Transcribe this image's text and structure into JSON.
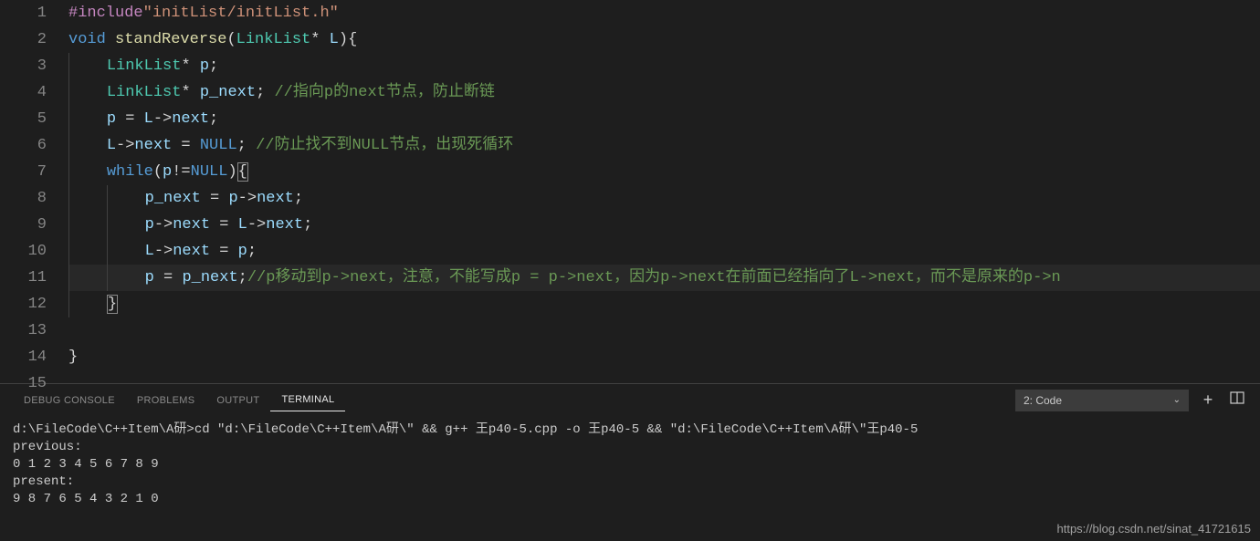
{
  "editor": {
    "lines": [
      {
        "num": "1",
        "indent": 0,
        "tokens": [
          {
            "t": "#include",
            "c": "tok-preproc"
          },
          {
            "t": "\"initList/initList.h\"",
            "c": "tok-string"
          }
        ]
      },
      {
        "num": "2",
        "indent": 0,
        "tokens": [
          {
            "t": "void",
            "c": "tok-keyword"
          },
          {
            "t": " ",
            "c": ""
          },
          {
            "t": "standReverse",
            "c": "tok-func"
          },
          {
            "t": "(",
            "c": "tok-punct"
          },
          {
            "t": "LinkList",
            "c": "tok-type"
          },
          {
            "t": "*",
            "c": "tok-op"
          },
          {
            "t": " ",
            "c": ""
          },
          {
            "t": "L",
            "c": "tok-var"
          },
          {
            "t": "){",
            "c": "tok-punct"
          }
        ]
      },
      {
        "num": "3",
        "indent": 1,
        "tokens": [
          {
            "t": "LinkList",
            "c": "tok-type"
          },
          {
            "t": "*",
            "c": "tok-op"
          },
          {
            "t": " ",
            "c": ""
          },
          {
            "t": "p",
            "c": "tok-var"
          },
          {
            "t": ";",
            "c": "tok-punct"
          }
        ]
      },
      {
        "num": "4",
        "indent": 1,
        "tokens": [
          {
            "t": "LinkList",
            "c": "tok-type"
          },
          {
            "t": "*",
            "c": "tok-op"
          },
          {
            "t": " ",
            "c": ""
          },
          {
            "t": "p_next",
            "c": "tok-var"
          },
          {
            "t": "; ",
            "c": "tok-punct"
          },
          {
            "t": "//指向p的next节点，防止断链",
            "c": "tok-comment"
          }
        ]
      },
      {
        "num": "5",
        "indent": 1,
        "tokens": [
          {
            "t": "p",
            "c": "tok-var"
          },
          {
            "t": " = ",
            "c": "tok-op"
          },
          {
            "t": "L",
            "c": "tok-var"
          },
          {
            "t": "->",
            "c": "tok-op"
          },
          {
            "t": "next",
            "c": "tok-var"
          },
          {
            "t": ";",
            "c": "tok-punct"
          }
        ]
      },
      {
        "num": "6",
        "indent": 1,
        "tokens": [
          {
            "t": "L",
            "c": "tok-var"
          },
          {
            "t": "->",
            "c": "tok-op"
          },
          {
            "t": "next",
            "c": "tok-var"
          },
          {
            "t": " = ",
            "c": "tok-op"
          },
          {
            "t": "NULL",
            "c": "tok-const"
          },
          {
            "t": "; ",
            "c": "tok-punct"
          },
          {
            "t": "//防止找不到NULL节点，出现死循环",
            "c": "tok-comment"
          }
        ]
      },
      {
        "num": "7",
        "indent": 1,
        "tokens": [
          {
            "t": "while",
            "c": "tok-keyword"
          },
          {
            "t": "(",
            "c": "tok-punct"
          },
          {
            "t": "p",
            "c": "tok-var"
          },
          {
            "t": "!=",
            "c": "tok-op"
          },
          {
            "t": "NULL",
            "c": "tok-const"
          },
          {
            "t": ")",
            "c": "tok-punct"
          },
          {
            "t": "{",
            "c": "tok-punct tok-bracket-hl"
          }
        ]
      },
      {
        "num": "8",
        "indent": 2,
        "tokens": [
          {
            "t": "p_next",
            "c": "tok-var"
          },
          {
            "t": " = ",
            "c": "tok-op"
          },
          {
            "t": "p",
            "c": "tok-var"
          },
          {
            "t": "->",
            "c": "tok-op"
          },
          {
            "t": "next",
            "c": "tok-var"
          },
          {
            "t": ";",
            "c": "tok-punct"
          }
        ]
      },
      {
        "num": "9",
        "indent": 2,
        "tokens": [
          {
            "t": "p",
            "c": "tok-var"
          },
          {
            "t": "->",
            "c": "tok-op"
          },
          {
            "t": "next",
            "c": "tok-var"
          },
          {
            "t": " = ",
            "c": "tok-op"
          },
          {
            "t": "L",
            "c": "tok-var"
          },
          {
            "t": "->",
            "c": "tok-op"
          },
          {
            "t": "next",
            "c": "tok-var"
          },
          {
            "t": ";",
            "c": "tok-punct"
          }
        ]
      },
      {
        "num": "10",
        "indent": 2,
        "tokens": [
          {
            "t": "L",
            "c": "tok-var"
          },
          {
            "t": "->",
            "c": "tok-op"
          },
          {
            "t": "next",
            "c": "tok-var"
          },
          {
            "t": " = ",
            "c": "tok-op"
          },
          {
            "t": "p",
            "c": "tok-var"
          },
          {
            "t": ";",
            "c": "tok-punct"
          }
        ]
      },
      {
        "num": "11",
        "indent": 2,
        "highlight": true,
        "tokens": [
          {
            "t": "p",
            "c": "tok-var"
          },
          {
            "t": " = ",
            "c": "tok-op"
          },
          {
            "t": "p_next",
            "c": "tok-var"
          },
          {
            "t": ";",
            "c": "tok-punct"
          },
          {
            "t": "//p移动到p->next，注意，不能写成p = p->next，因为p->next在前面已经指向了L->next，而不是原来的p->n",
            "c": "tok-comment"
          }
        ]
      },
      {
        "num": "12",
        "indent": 1,
        "tokens": [
          {
            "t": "}",
            "c": "tok-punct tok-bracket-hl"
          }
        ]
      },
      {
        "num": "13",
        "indent": 0,
        "tokens": []
      },
      {
        "num": "14",
        "indent": 0,
        "tokens": [
          {
            "t": "}",
            "c": "tok-punct"
          }
        ]
      },
      {
        "num": "15",
        "indent": 0,
        "tokens": []
      }
    ]
  },
  "panel": {
    "tabs": [
      {
        "label": "DEBUG CONSOLE",
        "active": false
      },
      {
        "label": "PROBLEMS",
        "active": false
      },
      {
        "label": "OUTPUT",
        "active": false
      },
      {
        "label": "TERMINAL",
        "active": true
      }
    ],
    "terminal_selector": "2: Code",
    "terminal_lines": [
      "d:\\FileCode\\C++Item\\A研>cd \"d:\\FileCode\\C++Item\\A研\\\" && g++ 王p40-5.cpp -o 王p40-5 && \"d:\\FileCode\\C++Item\\A研\\\"王p40-5",
      "previous:",
      "0 1 2 3 4 5 6 7 8 9",
      "present:",
      "9 8 7 6 5 4 3 2 1 0"
    ]
  },
  "watermark": "https://blog.csdn.net/sinat_41721615"
}
